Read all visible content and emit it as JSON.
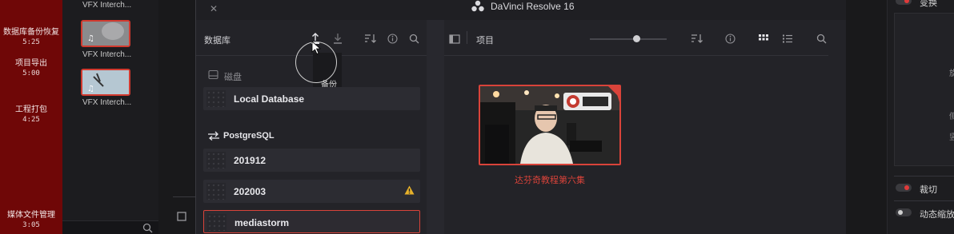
{
  "app": {
    "title": "DaVinci Resolve 16"
  },
  "chapters": [
    {
      "label": "数据库备份恢复",
      "time": "5:25"
    },
    {
      "label": "项目导出",
      "time": "5:00"
    },
    {
      "label": "工程打包",
      "time": "4:25"
    },
    {
      "label": "媒体文件管理",
      "time": "3:05"
    }
  ],
  "media_clips": [
    {
      "label": "VFX Interch..."
    },
    {
      "label": "VFX Interch..."
    },
    {
      "label": "VFX Interch..."
    }
  ],
  "database_panel": {
    "title": "数据库",
    "tooltip": "备份",
    "disk_section": "磁盘",
    "postgres_section": "PostgreSQL",
    "local_items": [
      {
        "name": "Local Database"
      }
    ],
    "postgres_items": [
      {
        "name": "201912",
        "warning": false
      },
      {
        "name": "202003",
        "warning": true
      },
      {
        "name": "mediastorm",
        "selected": true
      }
    ]
  },
  "projects_panel": {
    "title": "项目",
    "zoom_level": 0.61,
    "projects": [
      {
        "name": "达芬奇教程第六集"
      }
    ]
  },
  "inspector": {
    "top_label": "变换",
    "toggles": [
      {
        "label": "裁切",
        "on": true
      },
      {
        "label": "动态缩放",
        "on": false
      }
    ],
    "side_chars": [
      "旋",
      "侧",
      "竖"
    ]
  },
  "colors": {
    "accent": "#d9433a",
    "chapter_red": "#6f0707",
    "dialog_bg": "#28282e"
  }
}
